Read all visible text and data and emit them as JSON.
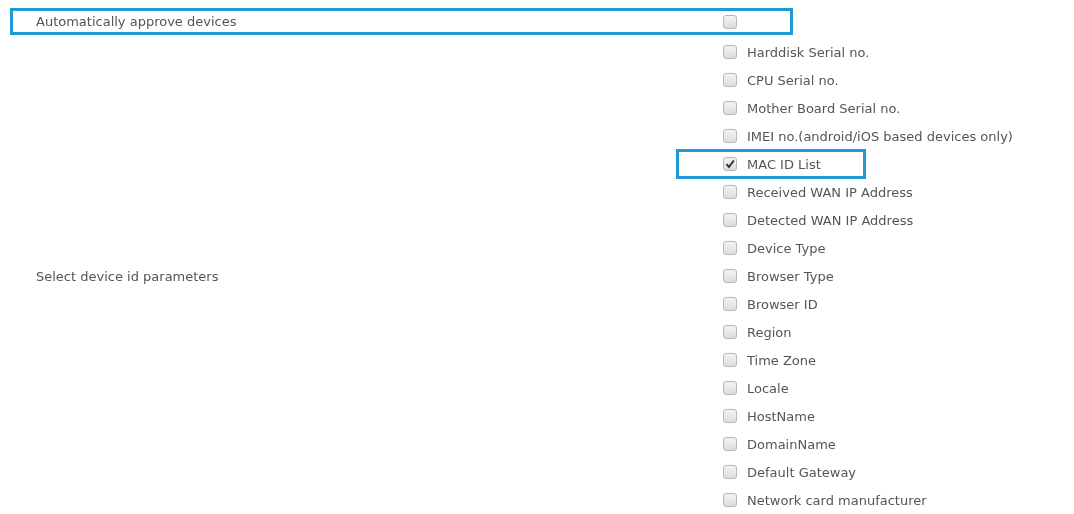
{
  "auto_approve": {
    "label": "Automatically approve devices",
    "checked": false,
    "highlighted": true
  },
  "device_id_parameters": {
    "label": "Select device id parameters",
    "items": [
      {
        "label": "Harddisk Serial no.",
        "checked": false,
        "highlighted": false
      },
      {
        "label": "CPU Serial no.",
        "checked": false,
        "highlighted": false
      },
      {
        "label": "Mother Board Serial no.",
        "checked": false,
        "highlighted": false
      },
      {
        "label": "IMEI no.(android/iOS based devices only)",
        "checked": false,
        "highlighted": false
      },
      {
        "label": "MAC ID List",
        "checked": true,
        "highlighted": true
      },
      {
        "label": "Received WAN IP Address",
        "checked": false,
        "highlighted": false
      },
      {
        "label": "Detected WAN IP Address",
        "checked": false,
        "highlighted": false
      },
      {
        "label": "Device Type",
        "checked": false,
        "highlighted": false
      },
      {
        "label": "Browser Type",
        "checked": false,
        "highlighted": false
      },
      {
        "label": "Browser ID",
        "checked": false,
        "highlighted": false
      },
      {
        "label": "Region",
        "checked": false,
        "highlighted": false
      },
      {
        "label": "Time Zone",
        "checked": false,
        "highlighted": false
      },
      {
        "label": "Locale",
        "checked": false,
        "highlighted": false
      },
      {
        "label": "HostName",
        "checked": false,
        "highlighted": false
      },
      {
        "label": "DomainName",
        "checked": false,
        "highlighted": false
      },
      {
        "label": "Default Gateway",
        "checked": false,
        "highlighted": false
      },
      {
        "label": "Network card manufacturer",
        "checked": false,
        "highlighted": false
      }
    ]
  }
}
